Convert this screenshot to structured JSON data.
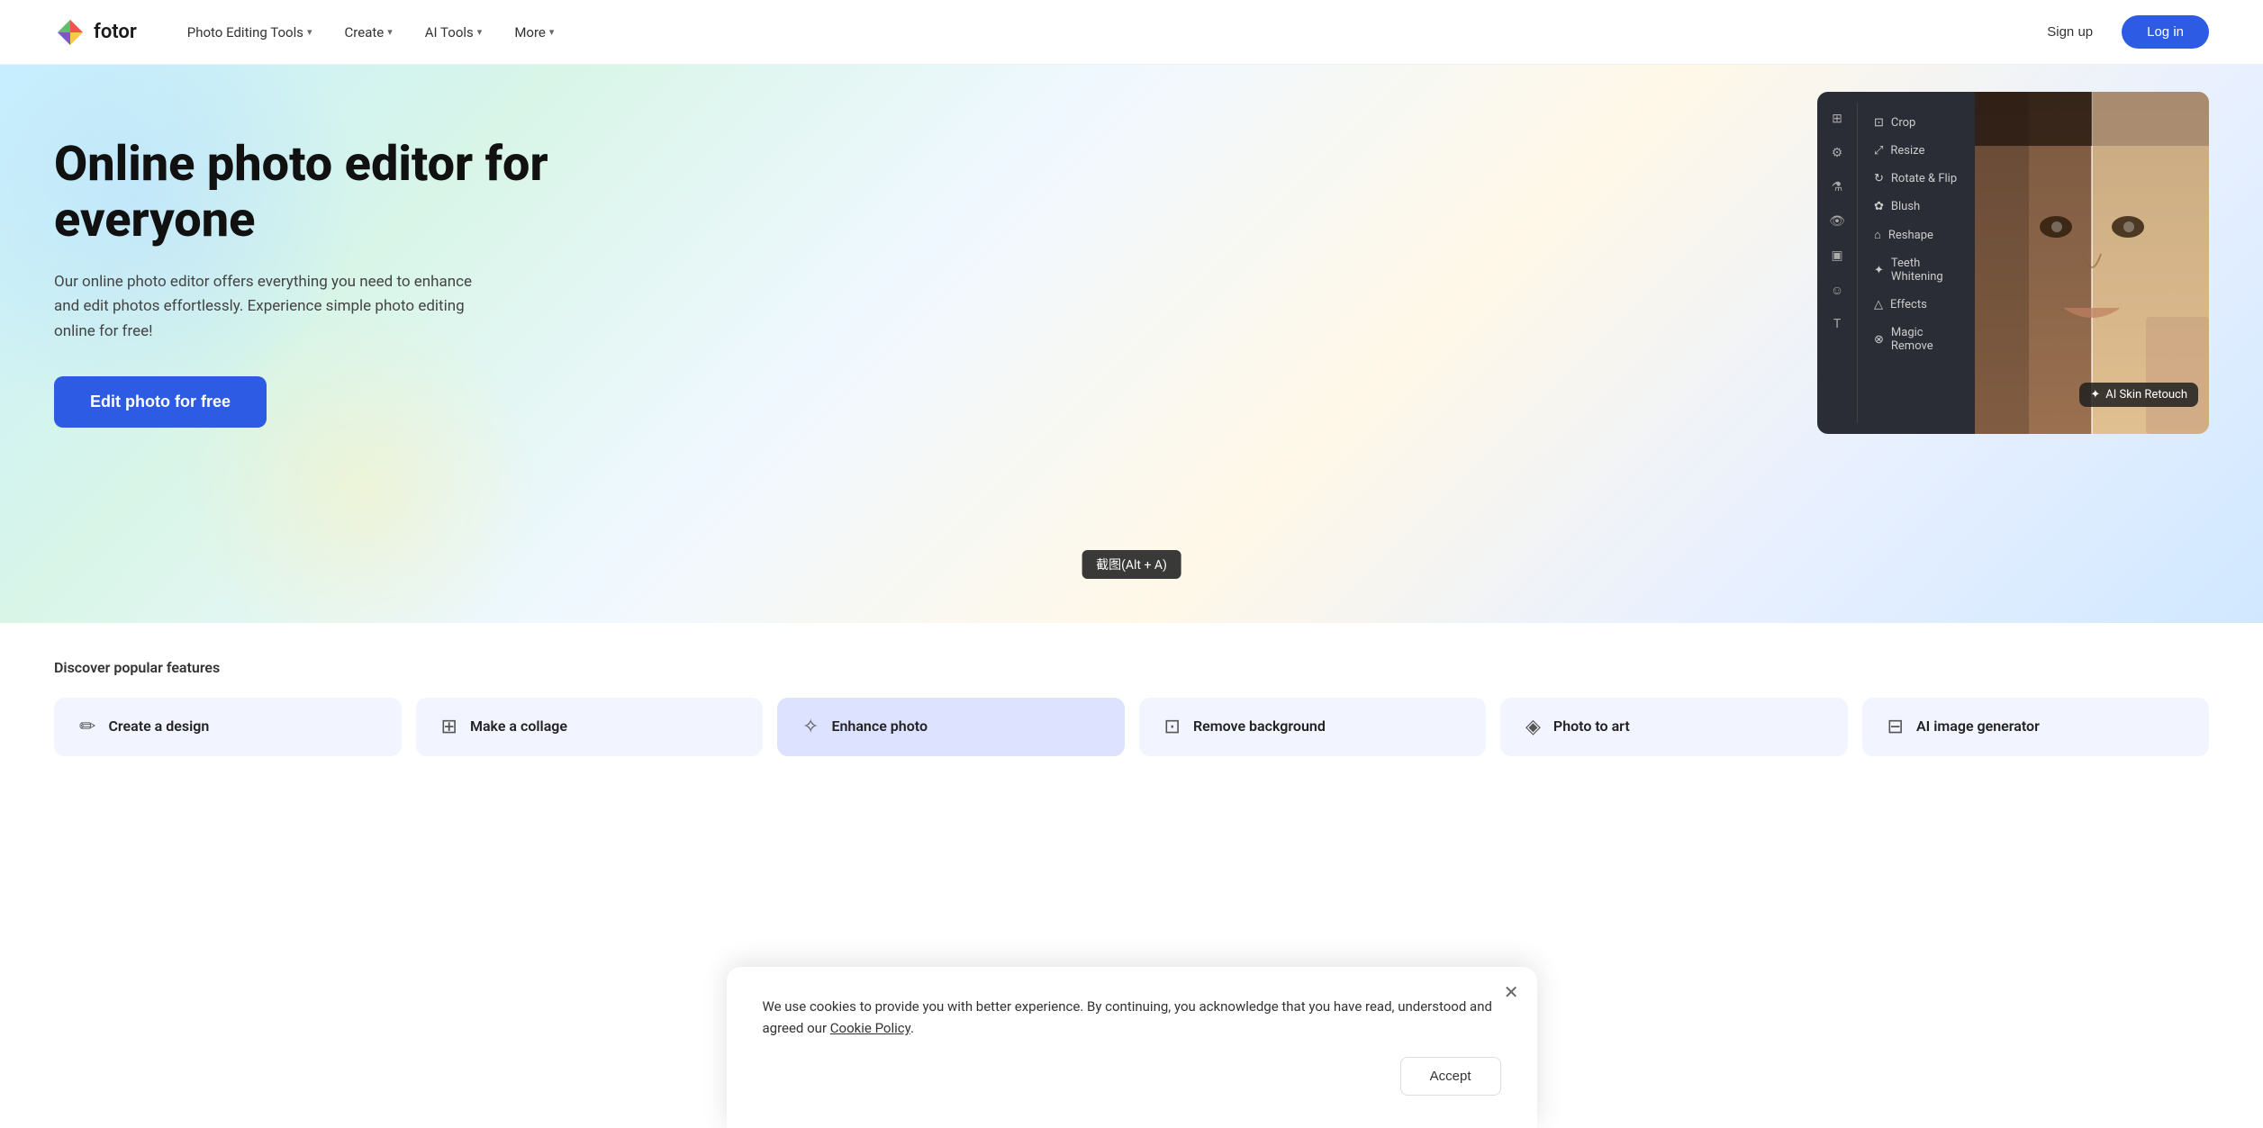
{
  "nav": {
    "logo_text": "fotor",
    "items": [
      {
        "label": "Photo Editing Tools",
        "has_chevron": true
      },
      {
        "label": "Create",
        "has_chevron": true
      },
      {
        "label": "AI Tools",
        "has_chevron": true
      },
      {
        "label": "More",
        "has_chevron": true
      }
    ],
    "signup_label": "Sign up",
    "login_label": "Log in"
  },
  "hero": {
    "title": "Online photo editor for everyone",
    "subtitle": "Our online photo editor offers everything you need to enhance and edit photos effortlessly. Experience simple photo editing online for free!",
    "cta_label": "Edit photo for free",
    "editor": {
      "menu_items": [
        {
          "icon": "⊡",
          "label": "Crop"
        },
        {
          "icon": "⤢",
          "label": "Resize"
        },
        {
          "icon": "↻",
          "label": "Rotate & Flip"
        },
        {
          "icon": "✿",
          "label": "Blush"
        },
        {
          "icon": "⌂",
          "label": "Reshape"
        },
        {
          "icon": "✦",
          "label": "Teeth Whitening"
        },
        {
          "icon": "△",
          "label": "Effects"
        },
        {
          "icon": "⊗",
          "label": "Magic Remove"
        }
      ],
      "ai_badge": "AI Skin Retouch"
    }
  },
  "features": {
    "section_title": "Discover popular features",
    "items": [
      {
        "icon": "✏",
        "label": "Create a design"
      },
      {
        "icon": "⊞",
        "label": "Make a collage"
      },
      {
        "icon": "✧",
        "label": "Enhance photo"
      },
      {
        "icon": "⊡",
        "label": "Remove background"
      },
      {
        "icon": "◈",
        "label": "Photo to art"
      },
      {
        "icon": "⊟",
        "label": "AI image generator"
      }
    ]
  },
  "cookie": {
    "text": "We use cookies to provide you with better experience. By continuing, you acknowledge that you have read, understood and agreed our",
    "link_label": "Cookie Policy",
    "period": ".",
    "accept_label": "Accept"
  },
  "screenshot_tooltip": "截图(Alt + A)"
}
